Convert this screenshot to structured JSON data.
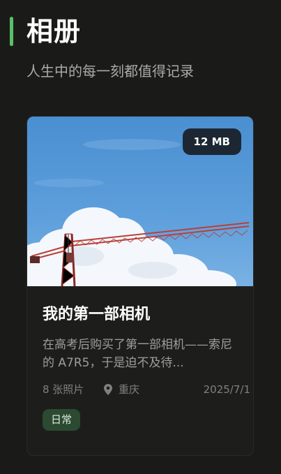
{
  "header": {
    "title": "相册",
    "subtitle": "人生中的每一刻都值得记录"
  },
  "album_card": {
    "size_badge": "12 MB",
    "title": "我的第一部相机",
    "description": "在高考后购买了第一部相机——索尼的 A7R5，于是迫不及待...",
    "photo_count": "8 张照片",
    "location": "重庆",
    "date": "2025/7/1",
    "tag": "日常",
    "image_icon": "crane-sky-photo",
    "location_icon": "map-pin-icon"
  },
  "colors": {
    "background": "#1a1b19",
    "accent": "#5bbf66",
    "tag_bg": "#2c4a31",
    "badge_bg": "#1d2733"
  }
}
